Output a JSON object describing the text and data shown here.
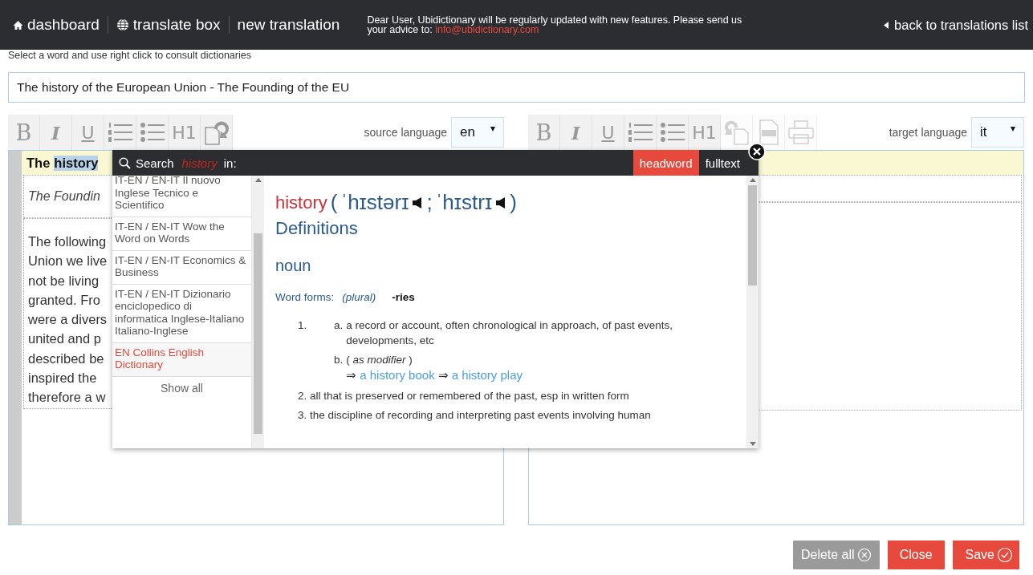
{
  "header": {
    "nav": [
      {
        "kind": "home",
        "label": "dashboard"
      },
      {
        "kind": "globe",
        "label": "translate box"
      },
      {
        "kind": "plain",
        "label": "new translation"
      }
    ],
    "notice": {
      "text": "Dear User, Ubidictionary will be regularly updated with new features. Please send us your advice to:",
      "email": "info@ubidictionary.com"
    },
    "back_link": "back to translations list"
  },
  "hint": "Select a word and use right click to consult dictionaries",
  "title_field": {
    "value": "The history of the European Union - The Founding of the EU"
  },
  "source_toolbar": {
    "buttons": [
      {
        "kind": "bold",
        "label": "B",
        "disabled": false
      },
      {
        "kind": "italic",
        "label": "I",
        "disabled": false
      },
      {
        "kind": "underline",
        "label": "U",
        "disabled": false
      },
      {
        "kind": "ordered-list",
        "disabled": false
      },
      {
        "kind": "bullet-list",
        "disabled": false
      },
      {
        "kind": "heading",
        "label": "H1",
        "disabled": false
      },
      {
        "kind": "import",
        "disabled": false
      }
    ],
    "language_label": "source language",
    "language": "en"
  },
  "target_toolbar": {
    "buttons": [
      {
        "kind": "bold",
        "label": "B",
        "disabled": false
      },
      {
        "kind": "italic",
        "label": "I",
        "disabled": false
      },
      {
        "kind": "underline",
        "label": "U",
        "disabled": false
      },
      {
        "kind": "ordered-list",
        "disabled": false
      },
      {
        "kind": "bullet-list",
        "disabled": false
      },
      {
        "kind": "heading",
        "label": "H1",
        "disabled": false
      },
      {
        "kind": "export",
        "disabled": true
      },
      {
        "kind": "doc",
        "disabled": true
      },
      {
        "kind": "print",
        "disabled": true
      }
    ],
    "language_label": "target language",
    "language": "it"
  },
  "source_editor": {
    "first_line": "The",
    "selected_word": "history",
    "subtitle": "The Foundin",
    "paragraph_lines": [
      "The following",
      "Union we live",
      "not be living",
      "granted. Fro",
      "were a divers",
      "united and p",
      "described be",
      "inspired the",
      "therefore a w"
    ]
  },
  "lookup_popup": {
    "search_label": "Search",
    "term": "history",
    "in_label": "in:",
    "tabs": [
      {
        "label": "headword",
        "selected": true
      },
      {
        "label": "fulltext",
        "selected": false
      }
    ],
    "dictionaries": [
      {
        "label": "IT-EN / EN-IT Il nuovo Inglese Tecnico e Scientifico",
        "selected": false
      },
      {
        "label": "IT-EN / EN-IT Wow the Word on Words",
        "selected": false
      },
      {
        "label": "IT-EN / EN-IT Economics & Business",
        "selected": false
      },
      {
        "label": "IT-EN / EN-IT Dizionario enciclopedico di informatica Inglese-Italiano Italiano-Inglese",
        "selected": false
      },
      {
        "label": "EN Collins English Dictionary",
        "selected": true
      }
    ],
    "show_all": "Show all",
    "entry": {
      "headword": "history",
      "open": "(",
      "pronunciations": [
        "ˈhɪstərɪ",
        "ˈhɪstrɪ"
      ],
      "separator": ";",
      "close": ")",
      "section": "Definitions",
      "part_of_speech": "noun",
      "word_forms_label": "Word forms:",
      "word_forms_note": "(plural)",
      "word_forms_value": "-ries",
      "sense_1": {
        "number": "1.",
        "a_label": "a.",
        "a_text": "a record or account, often chronological in approach, of past events, developments, etc",
        "b_label": "b.",
        "b_note": "( *as modifier* )",
        "arrow": "⇒",
        "examples": [
          "a history book",
          "a history play"
        ]
      },
      "senses": [
        "2. all that is preserved or remembered of the past, esp in written form",
        "3. the discipline of recording and interpreting past events involving human"
      ]
    }
  },
  "footer_buttons": [
    {
      "kind": "delete",
      "label": "Delete all"
    },
    {
      "kind": "close",
      "label": "Close"
    },
    {
      "kind": "save",
      "label": "Save"
    }
  ]
}
